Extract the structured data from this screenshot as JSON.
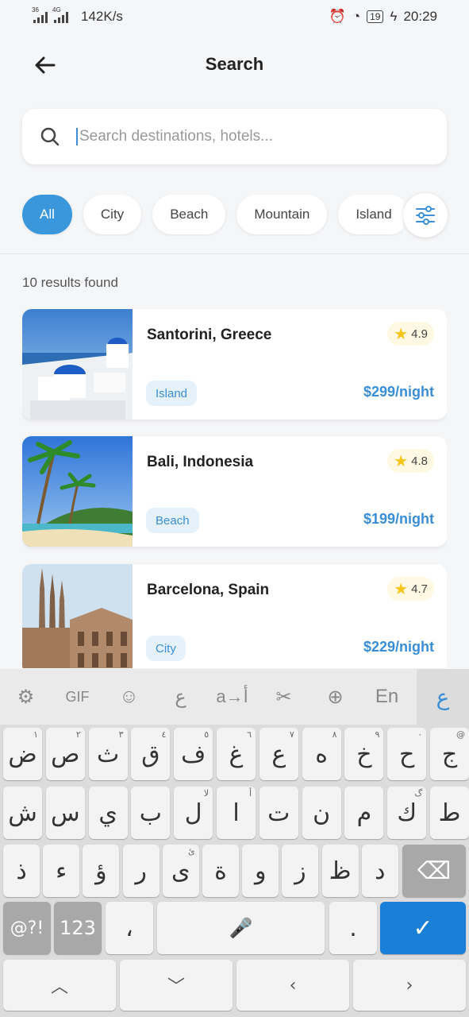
{
  "status_bar": {
    "network_a": "36",
    "network_b": "4G",
    "speed": "142K/s",
    "battery": "19",
    "time": "20:29"
  },
  "header": {
    "title": "Search",
    "back_icon": "arrow-left-icon"
  },
  "search": {
    "placeholder": "Search destinations, hotels...",
    "value": ""
  },
  "filters": {
    "chips": [
      "All",
      "City",
      "Beach",
      "Mountain",
      "Island"
    ],
    "active": "All",
    "filter_icon": "sliders-icon"
  },
  "results": {
    "count_text": "10 results found",
    "items": [
      {
        "name": "Santorini, Greece",
        "rating": "4.9",
        "tag": "Island",
        "price": "$299/night"
      },
      {
        "name": "Bali, Indonesia",
        "rating": "4.8",
        "tag": "Beach",
        "price": "$199/night"
      },
      {
        "name": "Barcelona, Spain",
        "rating": "4.7",
        "tag": "City",
        "price": "$229/night"
      }
    ]
  },
  "keyboard": {
    "toolbar": [
      "gear-icon",
      "GIF",
      "emoji-icon",
      "ع",
      "a→أ",
      "clipboard-icon",
      "globe-icon",
      "En",
      "ع"
    ],
    "row1": [
      {
        "k": "ض",
        "h": "١"
      },
      {
        "k": "ص",
        "h": "٢"
      },
      {
        "k": "ث",
        "h": "٣"
      },
      {
        "k": "ق",
        "h": "٤"
      },
      {
        "k": "ف",
        "h": "٥"
      },
      {
        "k": "غ",
        "h": "٦"
      },
      {
        "k": "ع",
        "h": "٧"
      },
      {
        "k": "ه",
        "h": "٨"
      },
      {
        "k": "خ",
        "h": "٩"
      },
      {
        "k": "ح",
        "h": "٠"
      },
      {
        "k": "ج",
        "h": "@"
      }
    ],
    "row2": [
      {
        "k": "ش",
        "h": ""
      },
      {
        "k": "س",
        "h": ""
      },
      {
        "k": "ي",
        "h": ""
      },
      {
        "k": "ب",
        "h": ""
      },
      {
        "k": "ل",
        "h": "لا"
      },
      {
        "k": "ا",
        "h": "أ"
      },
      {
        "k": "ت",
        "h": ""
      },
      {
        "k": "ن",
        "h": ""
      },
      {
        "k": "م",
        "h": ""
      },
      {
        "k": "ك",
        "h": "گ"
      },
      {
        "k": "ط",
        "h": ""
      }
    ],
    "row3": [
      {
        "k": "ذ",
        "h": ""
      },
      {
        "k": "ء",
        "h": ""
      },
      {
        "k": "ؤ",
        "h": ""
      },
      {
        "k": "ر",
        "h": ""
      },
      {
        "k": "ى",
        "h": "ئ"
      },
      {
        "k": "ة",
        "h": ""
      },
      {
        "k": "و",
        "h": ""
      },
      {
        "k": "ز",
        "h": ""
      },
      {
        "k": "ظ",
        "h": ""
      },
      {
        "k": "د",
        "h": ""
      }
    ],
    "symbols_key": "@?!",
    "numbers_key": "123",
    "comma_key": "،",
    "period_key": ".",
    "nav_keys": [
      "^",
      "v",
      "<",
      ">"
    ]
  }
}
